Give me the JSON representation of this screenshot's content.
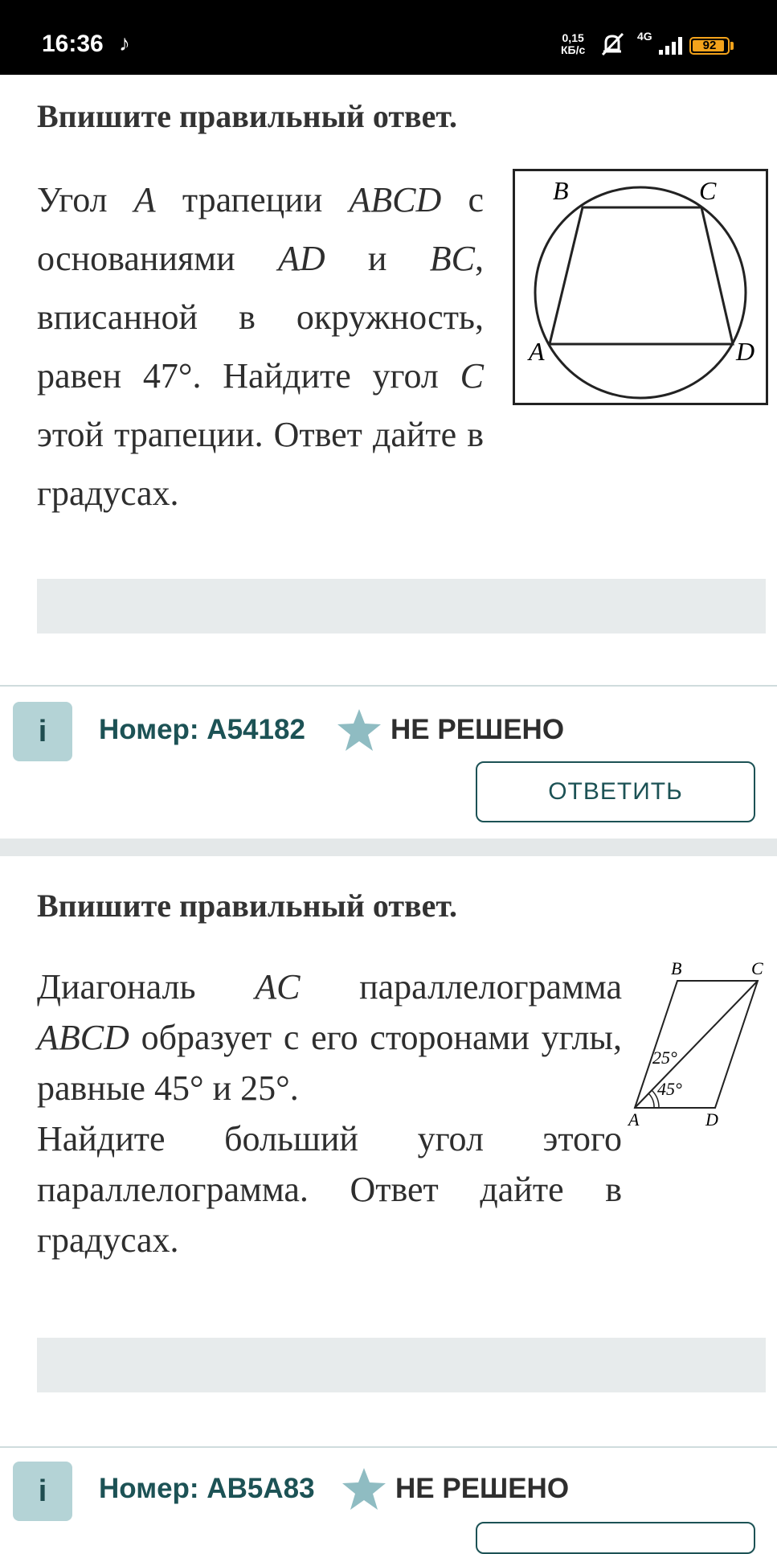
{
  "status_bar": {
    "time": "16:36",
    "tiktok_glyph": "♪",
    "speed_value": "0,15",
    "speed_unit": "КБ/с",
    "network": "4G",
    "battery": "92"
  },
  "tasks": [
    {
      "heading": "Впишите правильный ответ.",
      "text_parts": [
        "Угол ",
        "A",
        " трапеции ",
        "ABCD",
        " с основаниями ",
        "AD",
        " и ",
        "BC",
        ", вписанной в окружность, равен ",
        "47°",
        ". Найдите угол ",
        "C",
        " этой трапеции. Ответ дайте в градусах."
      ],
      "figure_labels": {
        "a": "A",
        "b": "B",
        "c": "C",
        "d": "D"
      },
      "number_label": "Номер: A54182",
      "status": "НЕ РЕШЕНО",
      "button_label": "ОТВЕТИТЬ",
      "info_label": "i"
    },
    {
      "heading": "Впишите правильный ответ.",
      "text_parts": [
        "Диагональ ",
        "AC",
        " параллелограмма ",
        "ABCD",
        " образует с его сторонами углы, равные ",
        "45°",
        " и ",
        "25°",
        ".",
        "Найдите больший угол этого параллелограмма. Ответ дайте в градусах."
      ],
      "figure_labels": {
        "a": "A",
        "b": "B",
        "c": "C",
        "d": "D",
        "angle1": "25°",
        "angle2": "45°"
      },
      "number_label": "Номер: AB5A83",
      "status": "НЕ РЕШЕНО",
      "info_label": "i"
    }
  ],
  "colors": {
    "accent": "#1c5255",
    "info_bg": "#b4d3d6",
    "star": "#8fbcc2",
    "answer_box": "#e7ebec"
  }
}
